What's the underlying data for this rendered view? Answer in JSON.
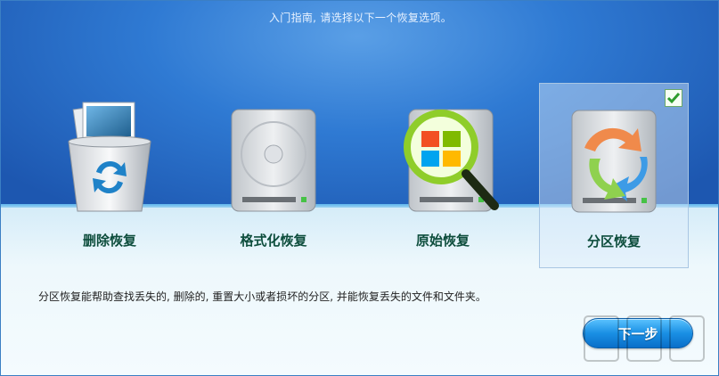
{
  "header": {
    "instruction": "入门指南, 请选择以下一个恢复选项。"
  },
  "options": [
    {
      "id": "delete",
      "label": "删除恢复",
      "icon": "recycle-bin-icon",
      "selected": false
    },
    {
      "id": "format",
      "label": "格式化恢复",
      "icon": "hard-drive-icon",
      "selected": false
    },
    {
      "id": "raw",
      "label": "原始恢复",
      "icon": "magnifier-drive-icon",
      "selected": false
    },
    {
      "id": "partition",
      "label": "分区恢复",
      "icon": "partition-drive-icon",
      "selected": true
    }
  ],
  "description": "分区恢复能帮助查找丢失的, 删除的, 重置大小或者损坏的分区, 并能恢复丢失的文件和文件夹。",
  "buttons": {
    "next": "下一步"
  },
  "colors": {
    "accent": "#1a8fe4",
    "header_bg": "#2f7ad3",
    "label": "#0d4d3c"
  }
}
